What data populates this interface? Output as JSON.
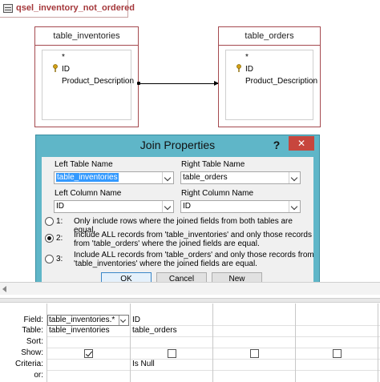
{
  "tab": {
    "title": "qsel_inventory_not_ordered"
  },
  "tables": [
    {
      "name": "table_inventories",
      "fields": [
        "*",
        "ID",
        "Product_Description"
      ]
    },
    {
      "name": "table_orders",
      "fields": [
        "*",
        "ID",
        "Product_Description"
      ]
    }
  ],
  "dialog": {
    "title": "Join Properties",
    "help": "?",
    "close": "✕",
    "left_table_label": "Left Table Name",
    "left_table_value": "table_inventories",
    "right_table_label": "Right Table Name",
    "right_table_value": "table_orders",
    "left_column_label": "Left Column Name",
    "left_column_value": "ID",
    "right_column_label": "Right Column Name",
    "right_column_value": "ID",
    "options": [
      {
        "num": "1:",
        "text": "Only include rows where the joined fields from both tables are equal.",
        "checked": false
      },
      {
        "num": "2:",
        "text": "Include ALL records from 'table_inventories' and only those records from 'table_orders' where the joined fields are equal.",
        "checked": true
      },
      {
        "num": "3:",
        "text": "Include ALL records from 'table_orders' and only those records from 'table_inventories' where the joined fields are equal.",
        "checked": false
      }
    ],
    "ok": "OK",
    "cancel": "Cancel",
    "new": "New"
  },
  "grid": {
    "row_labels": [
      "Field:",
      "Table:",
      "Sort:",
      "Show:",
      "Criteria:",
      "or:"
    ],
    "columns": [
      {
        "field": "table_inventories.*",
        "table": "table_inventories",
        "show": true,
        "criteria": ""
      },
      {
        "field": "ID",
        "table": "table_orders",
        "show": false,
        "criteria": "Is Null"
      },
      {
        "field": "",
        "table": "",
        "show": false,
        "criteria": ""
      },
      {
        "field": "",
        "table": "",
        "show": false,
        "criteria": ""
      },
      {
        "field": "",
        "table": "",
        "show": false,
        "criteria": ""
      }
    ]
  }
}
